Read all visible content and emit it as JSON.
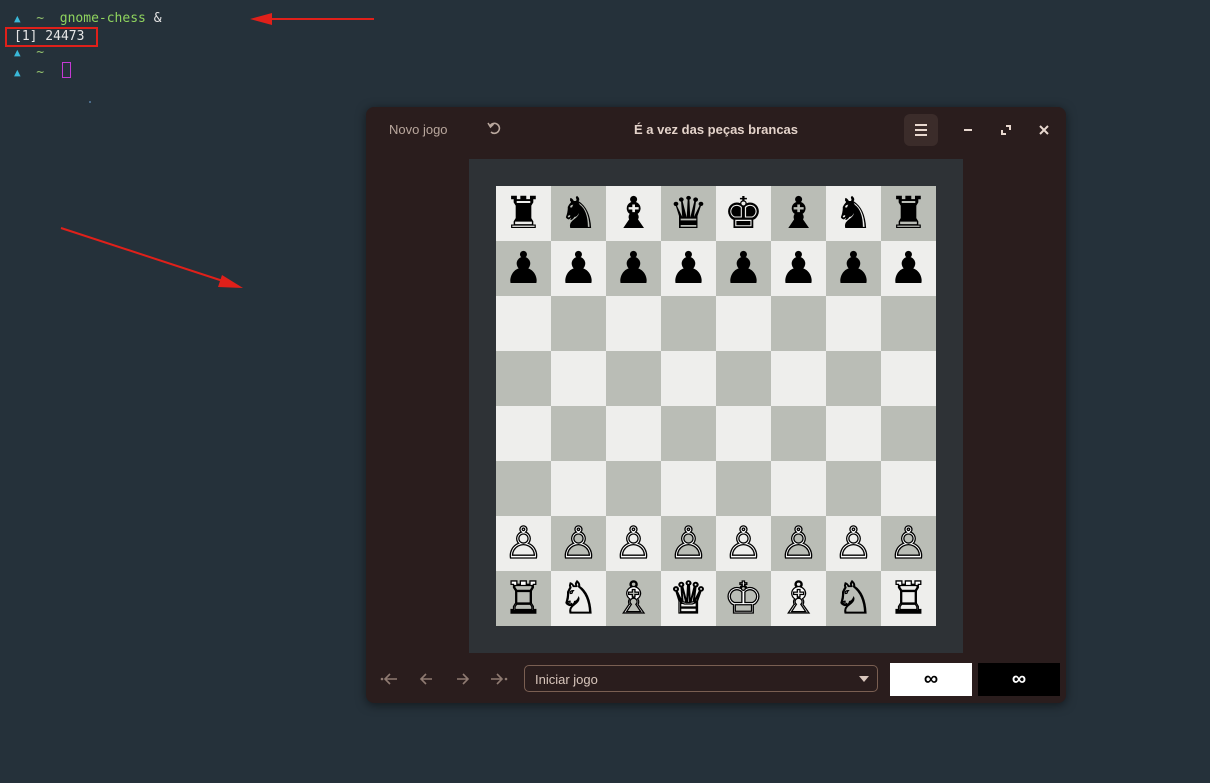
{
  "terminal": {
    "line1": {
      "tilde": "~",
      "command": "gnome-chess",
      "suffix": "&"
    },
    "line2": {
      "job": "[1] 24473"
    },
    "line3": {
      "tilde": "~"
    },
    "line4": {
      "tilde": "~"
    }
  },
  "window": {
    "new_game_label": "Novo jogo",
    "title": "É a vez das peças brancas",
    "start_select_value": "Iniciar jogo",
    "white_clock": "∞",
    "black_clock": "∞"
  },
  "board": {
    "ranks": [
      [
        "♜",
        "♞",
        "♝",
        "♛",
        "♚",
        "♝",
        "♞",
        "♜"
      ],
      [
        "♟",
        "♟",
        "♟",
        "♟",
        "♟",
        "♟",
        "♟",
        "♟"
      ],
      [
        "",
        "",
        "",
        "",
        "",
        "",
        "",
        ""
      ],
      [
        "",
        "",
        "",
        "",
        "",
        "",
        "",
        ""
      ],
      [
        "",
        "",
        "",
        "",
        "",
        "",
        "",
        ""
      ],
      [
        "",
        "",
        "",
        "",
        "",
        "",
        "",
        ""
      ],
      [
        "♙",
        "♙",
        "♙",
        "♙",
        "♙",
        "♙",
        "♙",
        "♙"
      ],
      [
        "♖",
        "♘",
        "♗",
        "♕",
        "♔",
        "♗",
        "♘",
        "♖"
      ]
    ]
  },
  "colors": {
    "light_square": "#eeeeec",
    "dark_square": "#babdb6",
    "annotation_red": "#e0201a"
  },
  "icons": {
    "undo": "undo-icon",
    "menu": "hamburger-menu-icon",
    "minimize": "minimize-icon",
    "maximize": "maximize-icon",
    "close": "close-icon",
    "first": "first-move-icon",
    "prev": "previous-move-icon",
    "next": "next-move-icon",
    "last": "last-move-icon"
  }
}
